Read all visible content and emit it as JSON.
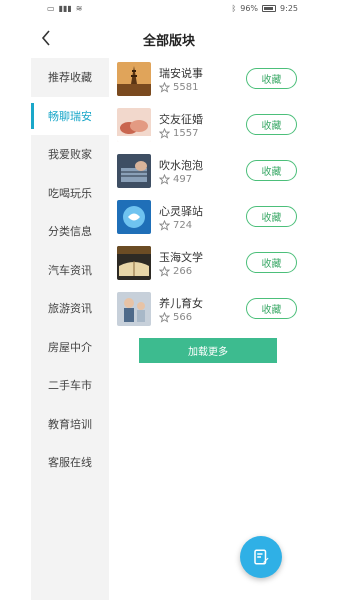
{
  "status_bar": {
    "signal_left": "46 ",
    "battery": "96%",
    "time": "9:25"
  },
  "header": {
    "title": "全部版块"
  },
  "sidebar": {
    "items": [
      {
        "label": "推荐收藏"
      },
      {
        "label": "畅聊瑞安"
      },
      {
        "label": "我爱败家"
      },
      {
        "label": "吃喝玩乐"
      },
      {
        "label": "分类信息"
      },
      {
        "label": "汽车资讯"
      },
      {
        "label": "旅游资讯"
      },
      {
        "label": "房屋中介"
      },
      {
        "label": "二手车市"
      },
      {
        "label": "教育培训"
      },
      {
        "label": "客服在线"
      }
    ],
    "active_index": 1
  },
  "forums": [
    {
      "name": "瑞安说事",
      "count": "5581",
      "button": "收藏",
      "thumb_color": "#c9893d"
    },
    {
      "name": "交友征婚",
      "count": "1557",
      "button": "收藏",
      "thumb_color": "#d88c74"
    },
    {
      "name": "吹水泡泡",
      "count": "497",
      "button": "收藏",
      "thumb_color": "#5a6f87"
    },
    {
      "name": "心灵驿站",
      "count": "724",
      "button": "收藏",
      "thumb_color": "#2f8fd6"
    },
    {
      "name": "玉海文学",
      "count": "266",
      "button": "收藏",
      "thumb_color": "#8a6a3b"
    },
    {
      "name": "养儿育女",
      "count": "566",
      "button": "收藏",
      "thumb_color": "#9aa7b5"
    }
  ],
  "load_more": "加载更多",
  "colors": {
    "accent": "#1aa7c9",
    "button_green": "#3dbb8f",
    "fab_blue": "#2fb0e6"
  }
}
